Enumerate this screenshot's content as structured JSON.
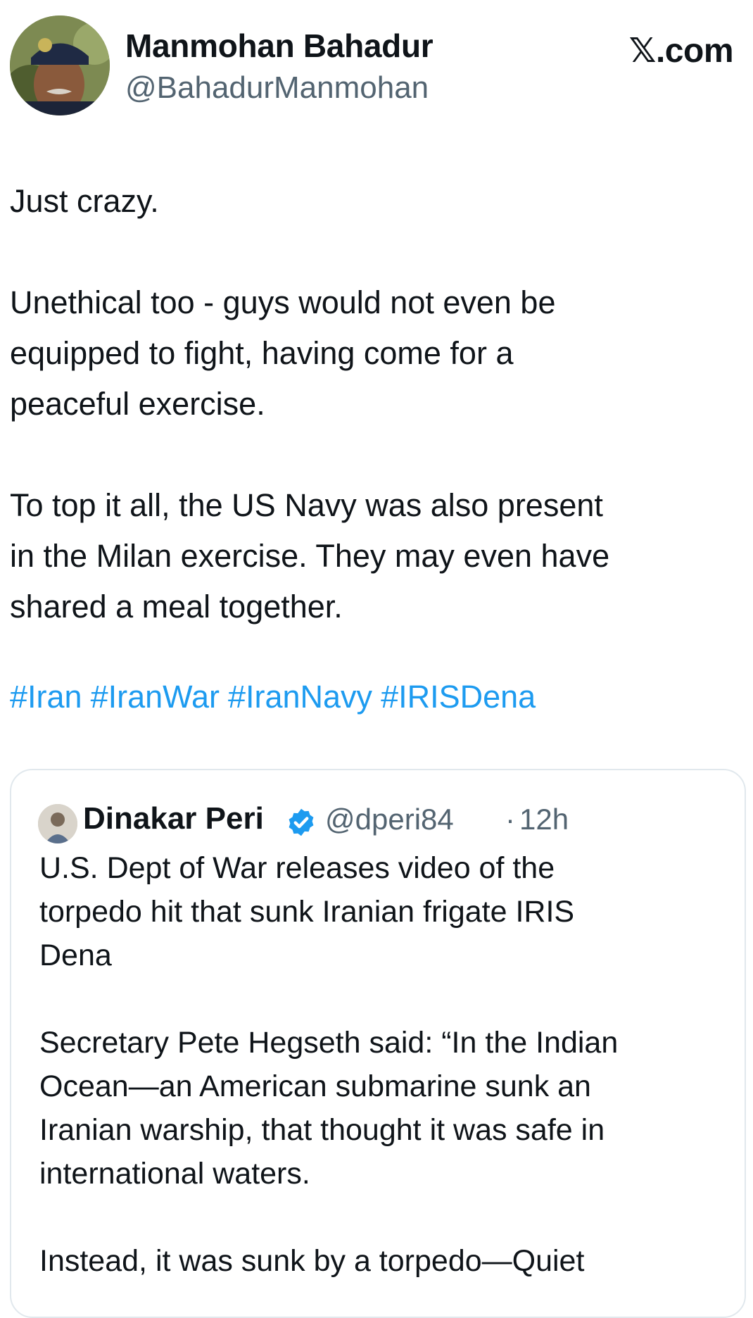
{
  "post": {
    "author_name": "Manmohan Bahadur",
    "author_handle": "@BahadurManmohan",
    "site_logo_mark": "𝕏",
    "site_logo_text": ".com",
    "paragraphs": [
      "Just crazy.",
      "Unethical too -  guys would not even be\nequipped to fight, having come for a\npeaceful exercise.",
      "To top it all, the US Navy was also present\nin the Milan exercise. They may even have\nshared a meal together."
    ],
    "hashtags": [
      "#Iran",
      "#IranWar",
      "#IranNavy",
      "#IRISDena"
    ]
  },
  "quoted": {
    "author_name": "Dinakar Peri",
    "author_handle": "@dperi84",
    "separator": "·",
    "time": "12h",
    "verified_icon": "verified-badge-icon",
    "paragraphs": [
      "U.S. Dept of War releases video of the\ntorpedo hit that sunk Iranian frigate IRIS\nDena",
      "Secretary Pete Hegseth said: “In the Indian\nOcean—an American submarine sunk an\nIranian warship, that thought it was safe in\ninternational waters.",
      "Instead, it was sunk by a torpedo—Quiet"
    ]
  },
  "colors": {
    "text": "#0f1419",
    "secondary": "#536471",
    "link": "#1d9bf0",
    "verified": "#1d9bf0",
    "border": "#e1e8ed"
  }
}
